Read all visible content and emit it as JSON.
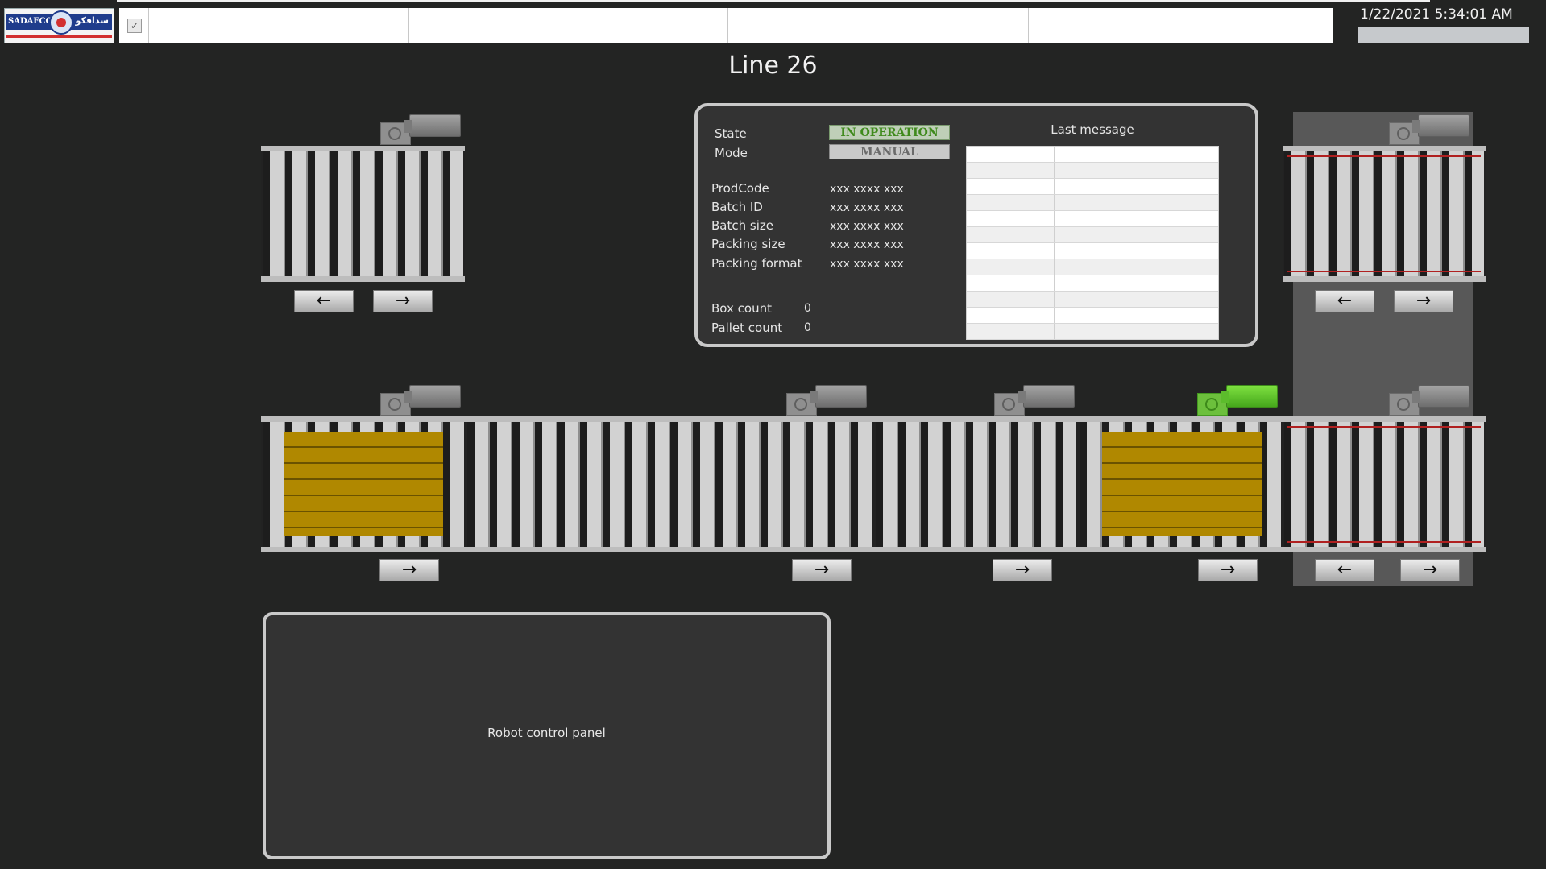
{
  "header": {
    "logo_text_en": "SADAFCO",
    "logo_text_ar": "سدافكو",
    "datetime": "1/22/2021 5:34:01 AM",
    "icon": "checklist-icon"
  },
  "page": {
    "title": "Line 26"
  },
  "info_panel": {
    "state_label": "State",
    "state_value": "IN OPERATION",
    "mode_label": "Mode",
    "mode_value": "MANUAL",
    "fields": [
      {
        "label": "ProdCode",
        "value": "xxx xxxx xxx"
      },
      {
        "label": "Batch ID",
        "value": "xxx xxxx xxx"
      },
      {
        "label": "Batch size",
        "value": "xxx xxxx xxx"
      },
      {
        "label": "Packing size",
        "value": "xxx xxxx xxx"
      },
      {
        "label": "Packing format",
        "value": "xxx xxxx xxx"
      }
    ],
    "counts": [
      {
        "label": "Box count",
        "value": "0"
      },
      {
        "label": "Pallet count",
        "value": "0"
      }
    ],
    "last_message_title": "Last message"
  },
  "conveyors": {
    "arrow_left": "←",
    "arrow_right": "→",
    "motor_active_color": "#6cc03c",
    "pallet_color": "#b08800"
  },
  "robot_panel": {
    "label": "Robot control panel"
  },
  "colors": {
    "background": "#232423",
    "state_ok": "#3f8a1c",
    "date_bar": "#c6c9cc"
  }
}
